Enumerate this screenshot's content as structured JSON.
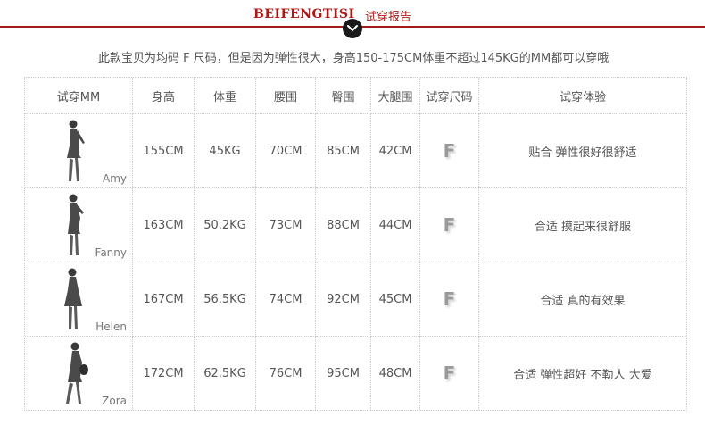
{
  "header": {
    "brand": "BEIFENGTISI",
    "title": "试穿报告"
  },
  "colors": {
    "accent": "#b01818",
    "text": "#555555",
    "border": "#c9c9c9"
  },
  "note": "此款宝贝为均码 F 尺码，但是因为弹性很大，身高150-175CM体重不超过145KG的MM都可以穿哦",
  "table": {
    "headers": [
      "试穿MM",
      "身高",
      "体重",
      "腰围",
      "臀围",
      "大腿围",
      "试穿尺码",
      "试穿体验"
    ],
    "rows": [
      {
        "name": "Amy",
        "height": "155CM",
        "weight": "45KG",
        "waist": "70CM",
        "hip": "85CM",
        "thigh": "42CM",
        "size": "F",
        "experience": "贴合 弹性很好很舒适"
      },
      {
        "name": "Fanny",
        "height": "163CM",
        "weight": "50.2KG",
        "waist": "73CM",
        "hip": "88CM",
        "thigh": "44CM",
        "size": "F",
        "experience": "合适 摸起来很舒服"
      },
      {
        "name": "Helen",
        "height": "167CM",
        "weight": "56.5KG",
        "waist": "74CM",
        "hip": "92CM",
        "thigh": "45CM",
        "size": "F",
        "experience": "合适 真的有效果"
      },
      {
        "name": "Zora",
        "height": "172CM",
        "weight": "62.5KG",
        "waist": "76CM",
        "hip": "95CM",
        "thigh": "48CM",
        "size": "F",
        "experience": "合适 弹性超好 不勒人 大爱"
      }
    ]
  }
}
